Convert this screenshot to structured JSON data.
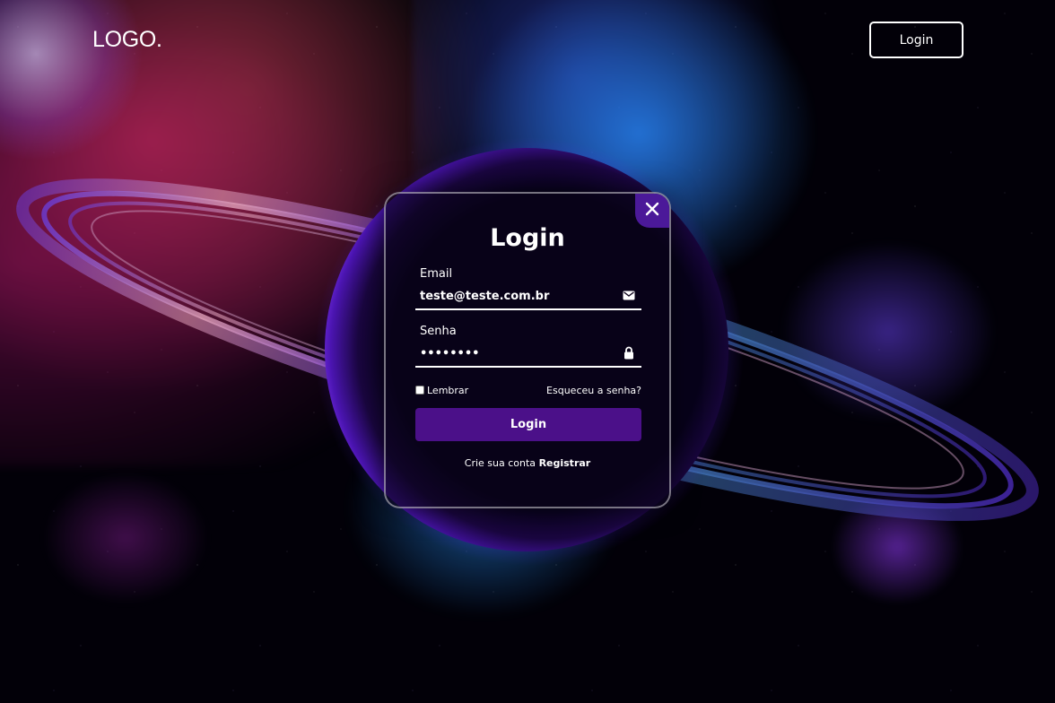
{
  "header": {
    "logo_text": "LOGO.",
    "login_button_label": "Login"
  },
  "login_card": {
    "title": "Login",
    "close_icon": "close-icon",
    "email": {
      "label": "Email",
      "value": "teste@teste.com.br",
      "icon": "envelope-icon"
    },
    "password": {
      "label": "Senha",
      "value": "••••••••",
      "icon": "lock-icon"
    },
    "remember_label": "Lembrar",
    "remember_checked": false,
    "forgot_link": "Esqueceu a senha?",
    "submit_label": "Login",
    "register_prompt": "Crie sua conta",
    "register_link": "Registrar"
  },
  "colors": {
    "accent": "#4b1089",
    "close_button": "#4b1999",
    "text": "#ffffff",
    "background": "#020008"
  }
}
